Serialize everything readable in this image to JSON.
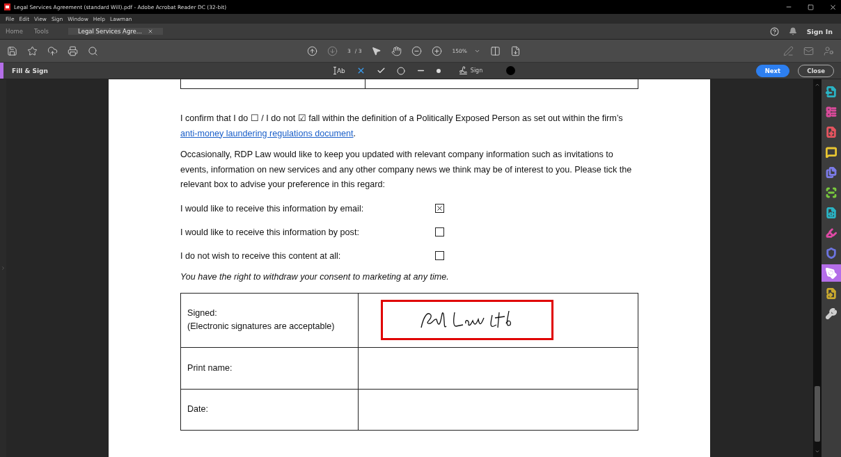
{
  "window": {
    "title": "Legal Services Agreement (standard Will).pdf - Adobe Acrobat Reader DC (32-bit)"
  },
  "menu": [
    "File",
    "Edit",
    "View",
    "Sign",
    "Window",
    "Help",
    "Lawman"
  ],
  "tabs": [
    {
      "label": "Home",
      "selected": false
    },
    {
      "label": "Tools",
      "selected": false
    },
    {
      "label": "Legal Services Agre...",
      "selected": true
    }
  ],
  "header_actions": {
    "sign_in": "Sign In"
  },
  "toolbar": {
    "page": "3",
    "page_total": "/ 3",
    "zoom": "150%"
  },
  "fill_sign": {
    "title": "Fill & Sign",
    "text_tool": "Ab",
    "sign": "Sign",
    "next": "Next",
    "close": "Close"
  },
  "document": {
    "confirm": "I confirm that I do ☐ / I do not ☑ fall within the definition of a Politically Exposed Person as set out within the firm’s ",
    "link": "anti-money laundering regulations document",
    "confirm_end": ".",
    "paragraph": "Occasionally, RDP Law would like to keep you updated with relevant company information such as invitations to events, information on new services and any other company news we think may be of interest to you. Please tick the relevant box to advise your preference in this regard:",
    "options": [
      {
        "label": "I would like to receive this information by email:",
        "checked": true
      },
      {
        "label": "I would like to receive this information by post:",
        "checked": false
      },
      {
        "label": "I do not wish to receive this content at all:",
        "checked": false
      }
    ],
    "notice": "You have the right to withdraw your consent to marketing at any time.",
    "table": [
      {
        "label": "Signed:",
        "note": "(Electronic signatures are acceptable)",
        "kind": "signature"
      },
      {
        "label": "Print name:",
        "kind": "empty"
      },
      {
        "label": "Date:",
        "kind": "empty"
      }
    ]
  },
  "tools_panel": [
    {
      "kind": "export",
      "color": "#2ab3c4",
      "selected": false
    },
    {
      "kind": "organize",
      "color": "#d94a9a",
      "selected": false
    },
    {
      "kind": "create",
      "color": "#e5545f",
      "selected": false
    },
    {
      "kind": "comment",
      "color": "#e8c531",
      "selected": false
    },
    {
      "kind": "combine",
      "color": "#7b7be8",
      "selected": false
    },
    {
      "kind": "scan",
      "color": "#78c93d",
      "selected": false
    },
    {
      "kind": "convert",
      "color": "#2ab3c4",
      "selected": false
    },
    {
      "kind": "edit",
      "color": "#e14aa6",
      "selected": false
    },
    {
      "kind": "protect",
      "color": "#6c74e0",
      "selected": false
    },
    {
      "kind": "fill",
      "color": "#ffffff",
      "selected": true
    },
    {
      "kind": "send",
      "color": "#c9a92e",
      "selected": false
    },
    {
      "kind": "more",
      "color": "#cfcfcf",
      "selected": false
    }
  ]
}
